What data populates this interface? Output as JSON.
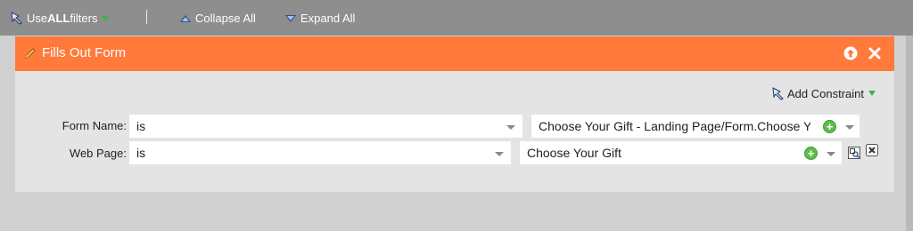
{
  "toolbar": {
    "use_filters_prefix": "Use ",
    "use_filters_bold": "ALL",
    "use_filters_suffix": " filters",
    "separator": "|",
    "collapse_all": "Collapse All",
    "expand_all": "Expand All"
  },
  "panel": {
    "title": "Fills Out Form",
    "add_constraint": "Add Constraint",
    "rows": [
      {
        "label": "Form Name:",
        "operator": "is",
        "value": "Choose Your Gift - Landing Page/Form.Choose Yo"
      },
      {
        "label": "Web Page:",
        "operator": "is",
        "value": "Choose Your Gift"
      }
    ]
  },
  "icons": {
    "filter": "filter-icon",
    "pencil": "pencil-icon",
    "move_up": "arrow-up-circle-icon",
    "close": "close-icon",
    "add": "plus-circle-icon",
    "select_page": "page-picker-icon",
    "remove": "remove-box-icon"
  },
  "colors": {
    "toolbar_bg": "#8e8e8e",
    "header_bg": "#ff7a3b",
    "panel_bg": "#e4e4e4",
    "plus_green": "#5fbd4b"
  }
}
